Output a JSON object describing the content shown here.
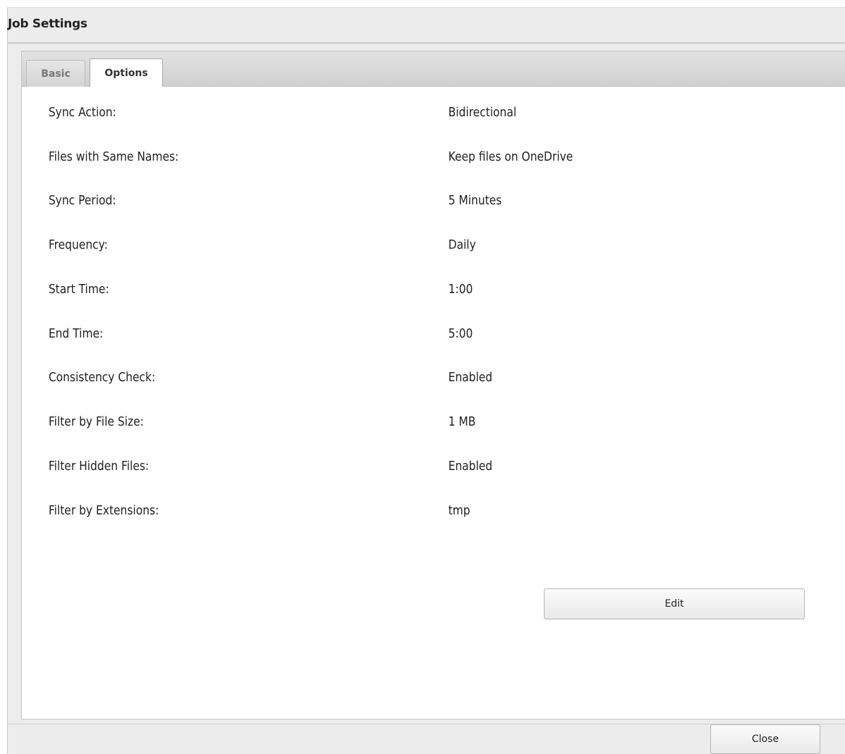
{
  "dialog": {
    "title": "Job Settings"
  },
  "tabs": [
    {
      "label": "Basic",
      "active": false
    },
    {
      "label": "Options",
      "active": true
    }
  ],
  "settings": [
    {
      "label": "Sync Action:",
      "value": "Bidirectional"
    },
    {
      "label": "Files with Same Names:",
      "value": "Keep files on OneDrive"
    },
    {
      "label": "Sync Period:",
      "value": "5 Minutes"
    },
    {
      "label": "Frequency:",
      "value": "Daily"
    },
    {
      "label": "Start Time:",
      "value": "1:00"
    },
    {
      "label": "End Time:",
      "value": "5:00"
    },
    {
      "label": "Consistency Check:",
      "value": "Enabled"
    },
    {
      "label": "Filter by File Size:",
      "value": "1 MB"
    },
    {
      "label": "Filter Hidden Files:",
      "value": "Enabled"
    },
    {
      "label": "Filter by Extensions:",
      "value": "tmp"
    }
  ],
  "buttons": {
    "edit_label": "Edit",
    "close_label": "Close"
  }
}
